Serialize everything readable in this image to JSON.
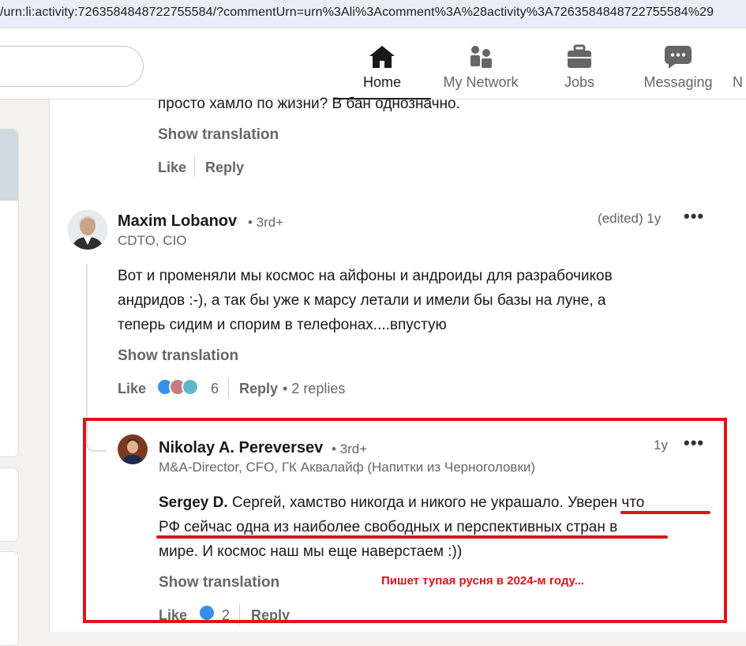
{
  "browser": {
    "url": "/urn:li:activity:7263584848722755584/?commentUrn=urn%3Ali%3Acomment%3A%28activity%3A7263584848722755584%29"
  },
  "nav": {
    "items": [
      {
        "label": "Home",
        "icon": "home-icon",
        "active": true
      },
      {
        "label": "My Network",
        "icon": "my-network-icon"
      },
      {
        "label": "Jobs",
        "icon": "briefcase-icon"
      },
      {
        "label": "Messaging",
        "icon": "messaging-icon"
      },
      {
        "label": "N"
      }
    ]
  },
  "colors": {
    "annotation": "#e0121c",
    "nav_active": "#191919",
    "reaction_like": "#378fe9"
  },
  "prev_comment": {
    "text_tail": "просто хамло по жизни? В бан однозначно.",
    "show_translation": "Show translation",
    "like": "Like",
    "reply": "Reply"
  },
  "comment1": {
    "author": "Maxim Lobanov",
    "degree": "• 3rd+",
    "headline": "CDTO, CIO",
    "time": "(edited) 1y",
    "more": "•••",
    "lines": [
      "Вот и променяли мы космос на айфоны и андроиды для разрабочиков",
      "андридов :-), а так бы уже к марсу летали и имели бы базы на луне, а",
      "теперь сидим и спорим в телефонах....впустую"
    ],
    "show_translation": "Show translation",
    "like": "Like",
    "reactions_count": "6",
    "reply": "Reply",
    "replies": "• 2 replies"
  },
  "reply1": {
    "author": "Nikolay A. Pereversev",
    "degree": "• 3rd+",
    "headline": "M&A-Director, CFO, ГК Аквалайф (Напитки из Черноголовки)",
    "time": "1y",
    "more": "•••",
    "mention": "Sergey D.",
    "line1_rest": " Сергей, хамство никогда и никого не украшало. Уверен что",
    "line2": "РФ сейчас одна из наиболее свободных и перспективных стран в",
    "line3": "мире. И космос наш мы еще наверстаем :))",
    "show_translation": "Show translation",
    "like": "Like",
    "reactions_count": "2",
    "reply": "Reply"
  },
  "annotation": "Пишет тупая русня в 2024-м году..."
}
